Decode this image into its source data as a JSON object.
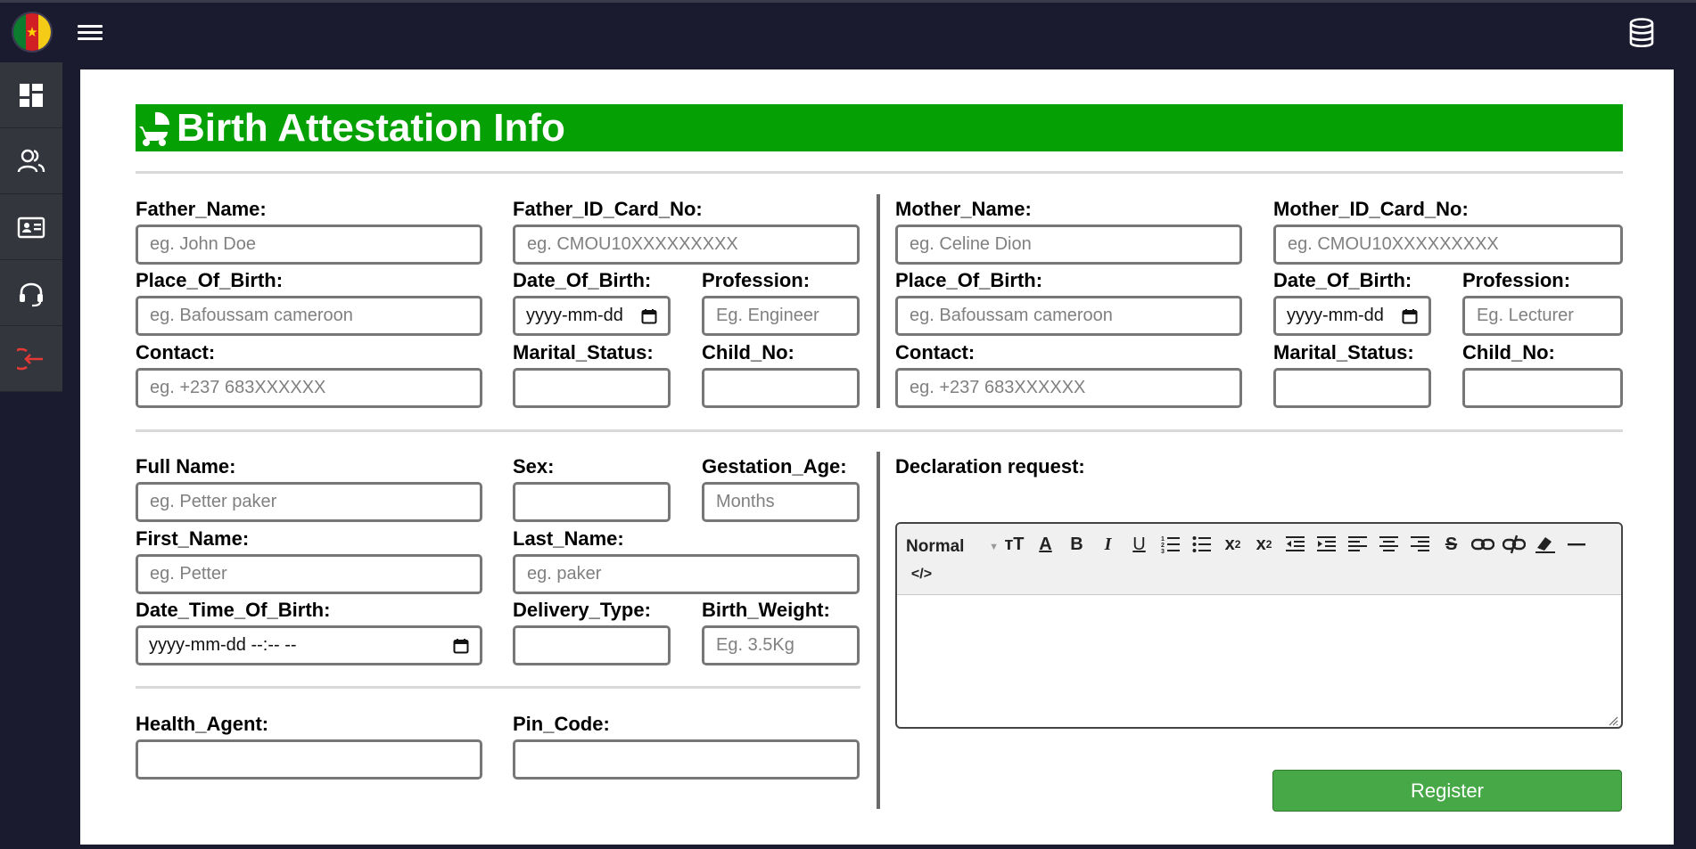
{
  "header": {
    "flag_icon": "cameroon-flag-icon",
    "menu_icon": "hamburger-icon",
    "db_icon": "database-icon"
  },
  "sidebar": {
    "items": [
      {
        "icon": "dashboard-icon"
      },
      {
        "icon": "users-icon"
      },
      {
        "icon": "id-card-icon"
      },
      {
        "icon": "headset-icon"
      },
      {
        "icon": "logout-icon"
      }
    ]
  },
  "page": {
    "title": "Birth Attestation Info",
    "title_icon": "baby-carriage-icon",
    "banner_color": "#04a004"
  },
  "father": {
    "name_label": "Father_Name:",
    "name_placeholder": "eg. John Doe",
    "id_label": "Father_ID_Card_No:",
    "id_placeholder": "eg. CMOU10XXXXXXXXX",
    "pob_label": "Place_Of_Birth:",
    "pob_placeholder": "eg. Bafoussam cameroon",
    "dob_label": "Date_Of_Birth:",
    "dob_value": "yyyy-mm-dd",
    "profession_label": "Profession:",
    "profession_placeholder": "Eg. Engineer",
    "contact_label": "Contact:",
    "contact_placeholder": "eg. +237 683XXXXXX",
    "marital_label": "Marital_Status:",
    "child_label": "Child_No:"
  },
  "mother": {
    "name_label": "Mother_Name:",
    "name_placeholder": "eg. Celine Dion",
    "id_label": "Mother_ID_Card_No:",
    "id_placeholder": "eg. CMOU10XXXXXXXXX",
    "pob_label": "Place_Of_Birth:",
    "pob_placeholder": "eg. Bafoussam cameroon",
    "dob_label": "Date_Of_Birth:",
    "dob_value": "yyyy-mm-dd",
    "profession_label": "Profession:",
    "profession_placeholder": "Eg. Lecturer",
    "contact_label": "Contact:",
    "contact_placeholder": "eg. +237 683XXXXXX",
    "marital_label": "Marital_Status:",
    "child_label": "Child_No:"
  },
  "child": {
    "fullname_label": "Full Name:",
    "fullname_placeholder": "eg. Petter paker",
    "sex_label": "Sex:",
    "gestation_label": "Gestation_Age:",
    "gestation_placeholder": "Months",
    "firstname_label": "First_Name:",
    "firstname_placeholder": "eg. Petter",
    "lastname_label": "Last_Name:",
    "lastname_placeholder": "eg. paker",
    "dtob_label": "Date_Time_Of_Birth:",
    "dtob_value": "yyyy-mm-dd --:-- --",
    "delivery_label": "Delivery_Type:",
    "weight_label": "Birth_Weight:",
    "weight_placeholder": "Eg. 3.5Kg"
  },
  "agent": {
    "health_label": "Health_Agent:",
    "pin_label": "Pin_Code:"
  },
  "declaration": {
    "label": "Declaration request:",
    "format_select": "Normal",
    "toolbar": [
      "text-size-icon",
      "text-color-icon",
      "bold-icon",
      "italic-icon",
      "underline-icon",
      "ordered-list-icon",
      "bullet-list-icon",
      "subscript-icon",
      "superscript-icon",
      "outdent-icon",
      "indent-icon",
      "align-left-icon",
      "align-center-icon",
      "align-right-icon",
      "strikethrough-icon",
      "link-icon",
      "unlink-icon",
      "eraser-icon",
      "horizontal-rule-icon",
      "code-view-icon"
    ]
  },
  "register_label": "Register"
}
